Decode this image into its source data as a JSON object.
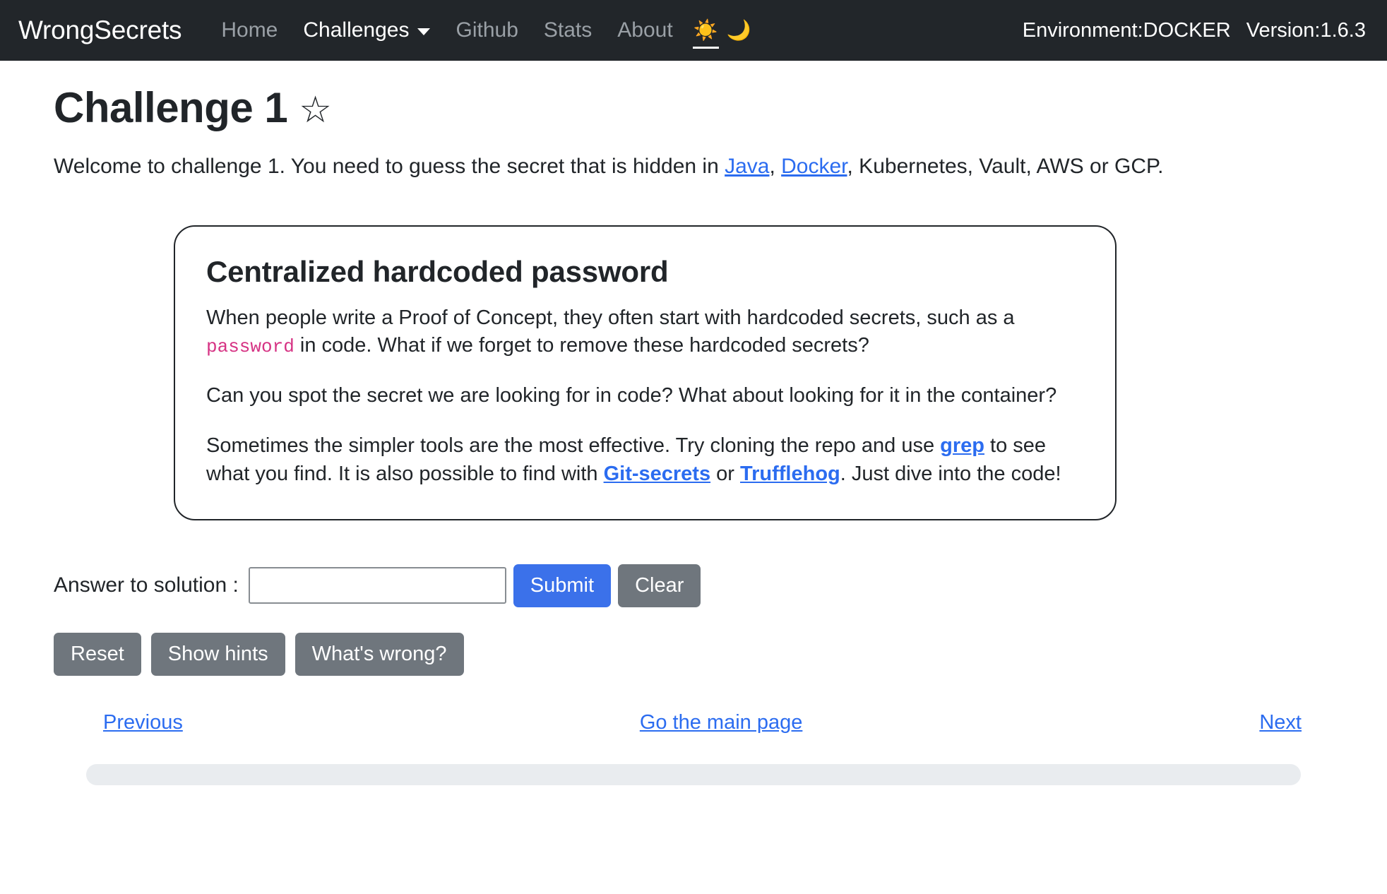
{
  "navbar": {
    "brand": "WrongSecrets",
    "links": [
      {
        "label": "Home",
        "active": false
      },
      {
        "label": "Challenges",
        "active": true,
        "has_caret": true
      },
      {
        "label": "Github",
        "active": false
      },
      {
        "label": "Stats",
        "active": false
      },
      {
        "label": "About",
        "active": false
      }
    ],
    "theme": {
      "light_icon": "☀️",
      "dark_icon": "🌙",
      "selected": "light"
    },
    "environment": "Environment:DOCKER",
    "version": "Version:1.6.3"
  },
  "header": {
    "title": "Challenge 1",
    "star_icon": "☆",
    "intro_prefix": "Welcome to challenge 1. You need to guess the secret that is hidden in ",
    "intro_link_java": "Java",
    "intro_sep_1": ", ",
    "intro_link_docker": "Docker",
    "intro_suffix": ", Kubernetes, Vault, AWS or GCP."
  },
  "challenge_card": {
    "title": "Centralized hardcoded password",
    "p1_part1": "When people write a Proof of Concept, they often start with hardcoded secrets, such as a ",
    "p1_code": "password",
    "p1_part2": " in code. What if we forget to remove these hardcoded secrets?",
    "p2": "Can you spot the secret we are looking for in code? What about looking for it in the container?",
    "p3_part1": "Sometimes the simpler tools are the most effective. Try cloning the repo and use ",
    "p3_link_grep": "grep",
    "p3_part2": " to see what you find. It is also possible to find with ",
    "p3_link_gitsecrets": "Git-secrets",
    "p3_part3": " or ",
    "p3_link_trufflehog": "Trufflehog",
    "p3_part4": ". Just dive into the code!"
  },
  "form": {
    "answer_label": "Answer to solution :",
    "answer_value": "",
    "answer_placeholder": "",
    "submit_label": "Submit",
    "clear_label": "Clear",
    "reset_label": "Reset",
    "show_hints_label": "Show hints",
    "whats_wrong_label": "What's wrong?"
  },
  "bottom_nav": {
    "previous": "Previous",
    "main_page": "Go the main page",
    "next": "Next"
  },
  "colors": {
    "navbar_bg": "#22262a",
    "link_blue": "#2b6cf0",
    "primary_button": "#3b71ea",
    "secondary_button": "#6f767d",
    "code_pink": "#d63384",
    "progress_track": "#e9ecef"
  }
}
